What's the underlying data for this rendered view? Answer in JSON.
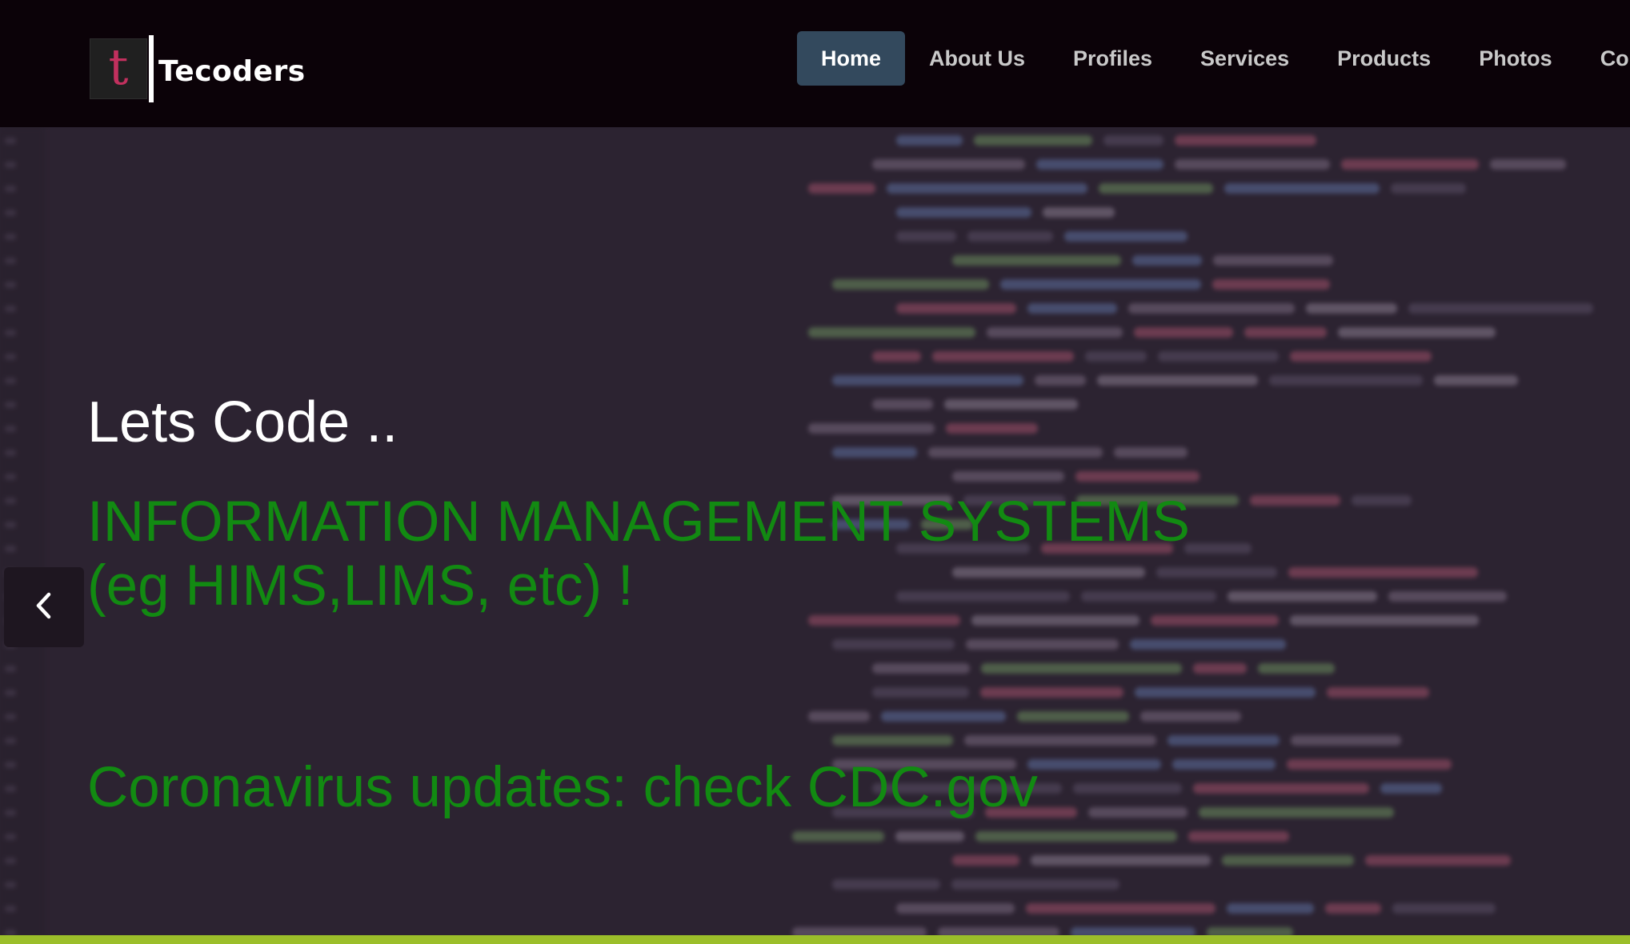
{
  "brand": {
    "logo_letter": "t",
    "name": "Tecoders",
    "logo_letter_color": "#c2305e"
  },
  "nav": {
    "items": [
      {
        "label": "Home",
        "active": true
      },
      {
        "label": "About Us"
      },
      {
        "label": "Profiles"
      },
      {
        "label": "Services"
      },
      {
        "label": "Products"
      },
      {
        "label": "Photos"
      },
      {
        "label": "Con"
      }
    ],
    "active_color": "#33495d"
  },
  "hero": {
    "title": "Lets Code ..",
    "subtitle": "INFORMATION MANAGEMENT SYSTEMS (eg HIMS,LIMS, etc) !",
    "link_text": "Coronavirus updates: check CDC.gov",
    "accent_color": "#128a12",
    "prev_icon": "chevron-left-icon"
  },
  "colors": {
    "navbar_bg": "#0b0208",
    "hero_bg": "#2c2331",
    "bottom_bar": "#9bbe2a"
  }
}
